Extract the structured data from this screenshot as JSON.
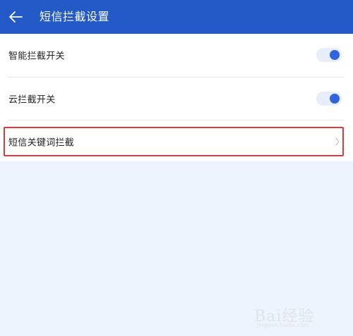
{
  "header": {
    "title": "短信拦截设置",
    "back_icon": "arrow-left-icon",
    "background_color": "#2459c8"
  },
  "settings": {
    "items": [
      {
        "label": "智能拦截开关",
        "type": "toggle",
        "enabled": true
      },
      {
        "label": "云拦截开关",
        "type": "toggle",
        "enabled": true
      },
      {
        "label": "短信关键词拦截",
        "type": "link",
        "icon": "chevron-right-icon"
      }
    ]
  },
  "colors": {
    "toggle_on": "#2f63e0",
    "highlight_border": "#e03b3b",
    "page_background": "#eef4fd"
  },
  "watermark": {
    "text": "Bai经验",
    "subtext": "jingyan.baidu.com"
  }
}
